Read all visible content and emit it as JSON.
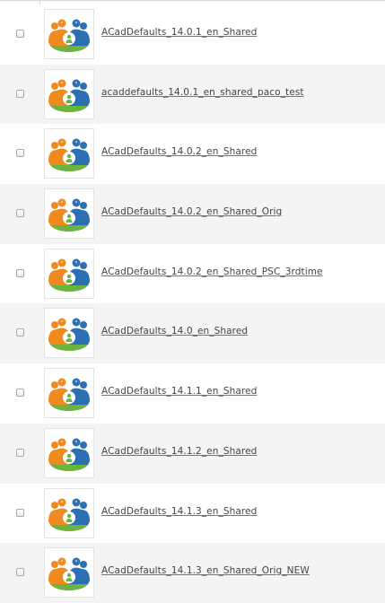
{
  "files": [
    {
      "name": "ACadDefaults_14.0.1_en_Shared"
    },
    {
      "name": "acaddefaults_14.0.1_en_shared_paco_test"
    },
    {
      "name": "ACadDefaults_14.0.2_en_Shared"
    },
    {
      "name": "ACadDefaults_14.0.2_en_Shared_Orig"
    },
    {
      "name": "ACadDefaults_14.0.2_en_Shared_PSC_3rdtime"
    },
    {
      "name": "ACadDefaults_14.0_en_Shared"
    },
    {
      "name": "ACadDefaults_14.1.1_en_Shared"
    },
    {
      "name": "ACadDefaults_14.1.2_en_Shared"
    },
    {
      "name": "ACadDefaults_14.1.3_en_Shared"
    },
    {
      "name": "ACadDefaults_14.1.3_en_Shared_Orig_NEW"
    }
  ],
  "icon": "shared-users-icon",
  "colors": {
    "orange": "#f0891e",
    "blue": "#2d6fb3",
    "green": "#6cb33f",
    "row_alt": "#f4f4f4"
  }
}
